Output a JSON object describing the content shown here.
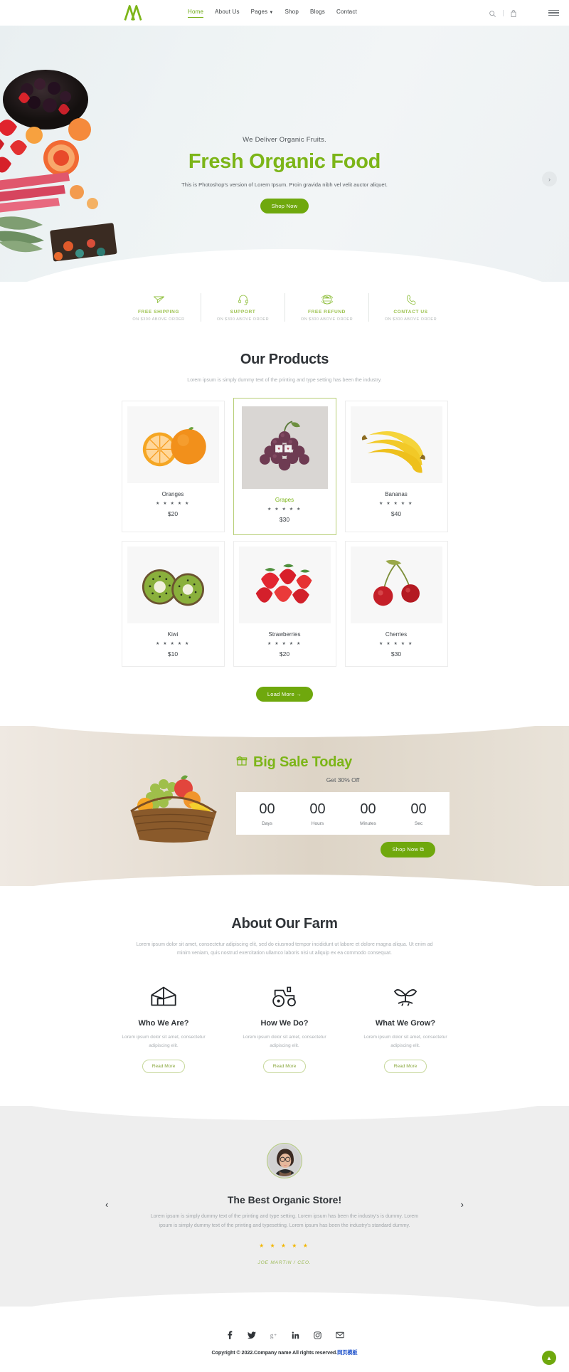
{
  "header": {
    "logo_icon": "double-peak-logo",
    "nav": [
      {
        "label": "Home",
        "active": true
      },
      {
        "label": "About Us",
        "active": false
      },
      {
        "label": "Pages",
        "active": false,
        "has_caret": true
      },
      {
        "label": "Shop",
        "active": false
      },
      {
        "label": "Blogs",
        "active": false
      },
      {
        "label": "Contact",
        "active": false
      }
    ],
    "search_icon": "search-icon",
    "cart_icon": "bag-icon",
    "menu_icon": "hamburger-icon",
    "accent": "#7cb518"
  },
  "hero": {
    "kicker": "We Deliver Organic Fruits.",
    "title": "Fresh Organic Food",
    "subtitle": "This is Photoshop's version of Lorem Ipsum. Proin gravida nibh vel velit auctor aliquet.",
    "cta": "Shop Now",
    "next_arrow": "›"
  },
  "features": [
    {
      "icon": "paper-plane-icon",
      "title": "FREE SHIPPING",
      "sub": "ON $300 ABOVE ORDER"
    },
    {
      "icon": "headset-icon",
      "title": "SUPPORT",
      "sub": "ON $300 ABOVE ORDER"
    },
    {
      "icon": "globe-refund-icon",
      "title": "FREE REFUND",
      "sub": "ON $300 ABOVE ORDER"
    },
    {
      "icon": "phone-icon",
      "title": "CONTACT US",
      "sub": "ON $300 ABOVE ORDER"
    }
  ],
  "products": {
    "title": "Our Products",
    "subtitle": "Lorem ipsum is simply dummy text of the printing and type setting has been the industry.",
    "stars": "★ ★ ★ ★ ★",
    "items": [
      {
        "name": "Oranges",
        "price": "$20",
        "featured": false,
        "image": "oranges-photo"
      },
      {
        "name": "Grapes",
        "price": "$30",
        "featured": true,
        "image": "grapes-photo"
      },
      {
        "name": "Bananas",
        "price": "$40",
        "featured": false,
        "image": "bananas-photo"
      },
      {
        "name": "Kiwi",
        "price": "$10",
        "featured": false,
        "image": "kiwi-photo"
      },
      {
        "name": "Strawberries",
        "price": "$20",
        "featured": false,
        "image": "strawberries-photo"
      },
      {
        "name": "Cherries",
        "price": "$30",
        "featured": false,
        "image": "cherries-photo"
      }
    ],
    "load_more": "Load More →"
  },
  "sale": {
    "gift_icon": "gift-icon",
    "title": "Big Sale Today",
    "off": "Get 30% Off",
    "counter": [
      {
        "value": "00",
        "label": "Days"
      },
      {
        "value": "00",
        "label": "Hours"
      },
      {
        "value": "00",
        "label": "Minutes"
      },
      {
        "value": "00",
        "label": "Sec"
      }
    ],
    "cta": "Shop Now ⧉",
    "basket_image": "fruit-basket-photo"
  },
  "about": {
    "title": "About Our Farm",
    "text": "Lorem ipsum dolor sit amet, consectetur adipiscing elit, sed do eiusmod tempor incididunt ut labore et dolore magna aliqua. Ut enim ad minim veniam, quis nostrud exercitation ullamco laboris nisi ut aliquip ex ea commodo consequat.",
    "columns": [
      {
        "icon": "barn-house-icon",
        "title": "Who We Are?",
        "text": "Lorem ipsum dolor sit amet, consectetur adipiscing elit.",
        "button": "Read More"
      },
      {
        "icon": "tractor-icon",
        "title": "How We Do?",
        "text": "Lorem ipsum dolor sit amet, consectetur adipiscing elit.",
        "button": "Read More"
      },
      {
        "icon": "sprout-icon",
        "title": "What We Grow?",
        "text": "Lorem ipsum dolor sit amet, consectetur adipiscing elit.",
        "button": "Read More"
      }
    ]
  },
  "testimonial": {
    "avatar": "woman-with-glasses-photo",
    "title": "The Best Organic Store!",
    "text": "Lorem ipsum is simply dummy text of the printing and type setting. Lorem ipsum has been the industry's is dummy. Lorem ipsum is simply dummy text of the printing and typesetting. Lorem ipsum has been the industry's standard dummy.",
    "stars": "★ ★ ★ ★ ★",
    "author": "JOE MARTIN / CEO.",
    "prev": "‹",
    "next": "›"
  },
  "footer": {
    "socials": [
      {
        "icon": "facebook-icon",
        "glyph": "f"
      },
      {
        "icon": "twitter-icon",
        "glyph": "ᵗ"
      },
      {
        "icon": "google-plus-icon",
        "glyph": "g"
      },
      {
        "icon": "linkedin-icon",
        "glyph": "in"
      },
      {
        "icon": "instagram-icon",
        "glyph": "▢"
      },
      {
        "icon": "email-icon",
        "glyph": "✉"
      }
    ],
    "copyright": "Copyright © 2022.Company name All rights reserved.",
    "link_text": "网页模板",
    "to_top_icon": "arrow-up-icon"
  }
}
